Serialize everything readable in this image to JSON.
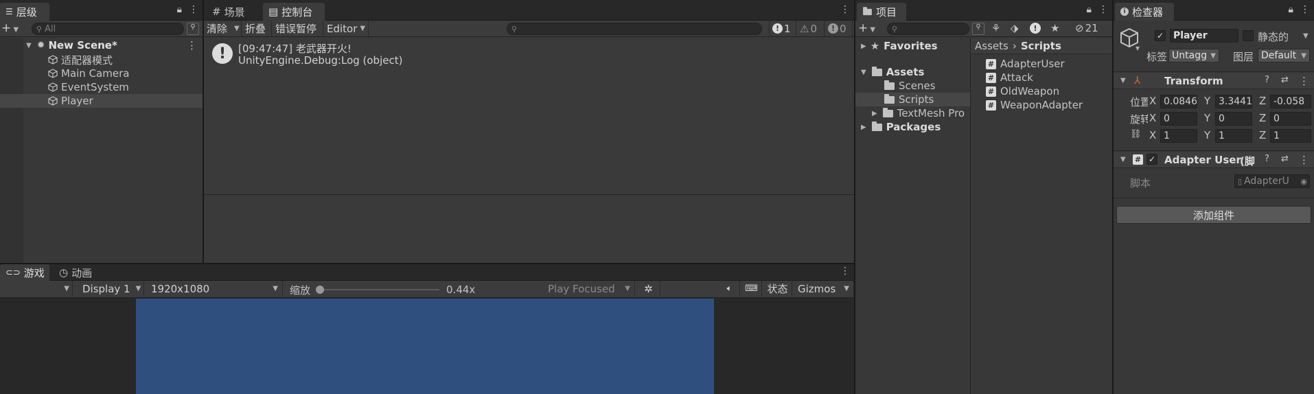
{
  "hierarchy": {
    "tab_label": "层级",
    "search_placeholder": "All",
    "scene_name": "New Scene*",
    "items": [
      {
        "label": "适配器模式"
      },
      {
        "label": "Main Camera"
      },
      {
        "label": "EventSystem"
      },
      {
        "label": "Player"
      }
    ]
  },
  "scene_tab": {
    "label": "场景"
  },
  "console": {
    "tab_label": "控制台",
    "toolbar": {
      "clear": "清除",
      "collapse": "折叠",
      "error_pause": "错误暂停",
      "editor": "Editor"
    },
    "counts": {
      "info": "1",
      "warn": "0",
      "error": "0"
    },
    "log": {
      "line1": "[09:47:47] 老武器开火!",
      "line2": "UnityEngine.Debug:Log (object)"
    }
  },
  "game": {
    "tab_label": "游戏",
    "anim_tab_label": "动画",
    "display": "Display 1",
    "resolution": "1920x1080",
    "scale_label": "缩放",
    "scale_value": "0.44x",
    "scale_fraction": 0.0,
    "play_mode": "Play Focused",
    "stats": "状态",
    "gizmos": "Gizmos",
    "viewport_color": "#2f4f7f"
  },
  "project": {
    "tab_label": "项目",
    "hidden_count": "21",
    "tree": {
      "favorites": "Favorites",
      "assets": "Assets",
      "scenes": "Scenes",
      "scripts": "Scripts",
      "textmesh": "TextMesh Pro",
      "packages": "Packages"
    },
    "breadcrumb": {
      "root": "Assets",
      "current": "Scripts"
    },
    "files": [
      {
        "label": "AdapterUser"
      },
      {
        "label": "Attack"
      },
      {
        "label": "OldWeapon"
      },
      {
        "label": "WeaponAdapter"
      }
    ]
  },
  "inspector": {
    "tab_label": "检查器",
    "object_name": "Player",
    "static_label": "静态的",
    "tag_label": "标签",
    "tag_value": "Untagg",
    "layer_label": "图层",
    "layer_value": "Default",
    "transform": {
      "title": "Transform",
      "position_label": "位置",
      "rotation_label": "旋转",
      "scale_label": "",
      "x": "X",
      "y": "Y",
      "z": "Z",
      "position": {
        "x": "0.0846",
        "y": "3.3441",
        "z": "-0.058"
      },
      "rotation": {
        "x": "0",
        "y": "0",
        "z": "0"
      },
      "scale": {
        "x": "1",
        "y": "1",
        "z": "1"
      }
    },
    "component": {
      "title": "Adapter User",
      "title_suffix": "(脚",
      "script_label": "脚本",
      "script_value": "AdapterU"
    },
    "add_component": "添加组件"
  }
}
